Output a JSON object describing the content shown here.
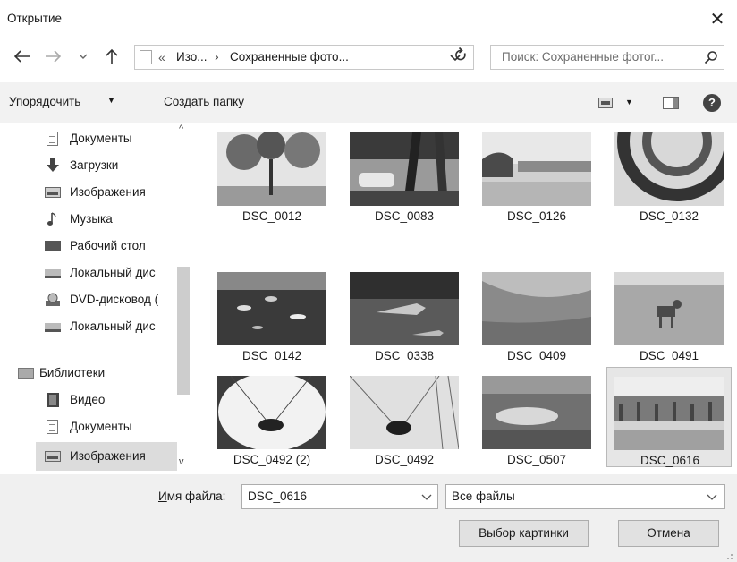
{
  "window": {
    "title": "Открытие",
    "close_glyph": "✕"
  },
  "nav": {
    "address": {
      "overflow": "«",
      "part1": "Изо...",
      "separator": "›",
      "part2": "Сохраненные фото..."
    },
    "search_placeholder": "Поиск: Сохраненные фотог..."
  },
  "toolbar": {
    "organize": "Упорядочить",
    "new_folder": "Создать папку",
    "help": "?"
  },
  "sidebar": {
    "items": [
      {
        "label": "Документы",
        "icon": "document-icon"
      },
      {
        "label": "Загрузки",
        "icon": "download-icon"
      },
      {
        "label": "Изображения",
        "icon": "pictures-icon"
      },
      {
        "label": "Музыка",
        "icon": "music-icon"
      },
      {
        "label": "Рабочий стол",
        "icon": "desktop-icon"
      },
      {
        "label": "Локальный дис",
        "icon": "local-disk-icon"
      },
      {
        "label": "DVD-дисковод (",
        "icon": "dvd-drive-icon"
      },
      {
        "label": "Локальный дис",
        "icon": "local-disk-icon"
      },
      {
        "label": "Библиотеки",
        "icon": "libraries-icon"
      },
      {
        "label": "Видео",
        "icon": "video-icon"
      },
      {
        "label": "Документы",
        "icon": "document-icon"
      },
      {
        "label": "Изображения",
        "icon": "pictures-icon",
        "selected": true
      }
    ]
  },
  "files": [
    {
      "name": "DSC_0012"
    },
    {
      "name": "DSC_0083"
    },
    {
      "name": "DSC_0126"
    },
    {
      "name": "DSC_0132"
    },
    {
      "name": "DSC_0142"
    },
    {
      "name": "DSC_0338"
    },
    {
      "name": "DSC_0409"
    },
    {
      "name": "DSC_0491"
    },
    {
      "name": "DSC_0492 (2)"
    },
    {
      "name": "DSC_0492"
    },
    {
      "name": "DSC_0507"
    },
    {
      "name": "DSC_0616",
      "selected": true
    }
  ],
  "footer": {
    "filename_label_access": "И",
    "filename_label_rest": "мя файла:",
    "filename_value": "DSC_0616",
    "filetype_value": "Все файлы",
    "ok_label": "Выбор картинки",
    "cancel_label": "Отмена"
  }
}
